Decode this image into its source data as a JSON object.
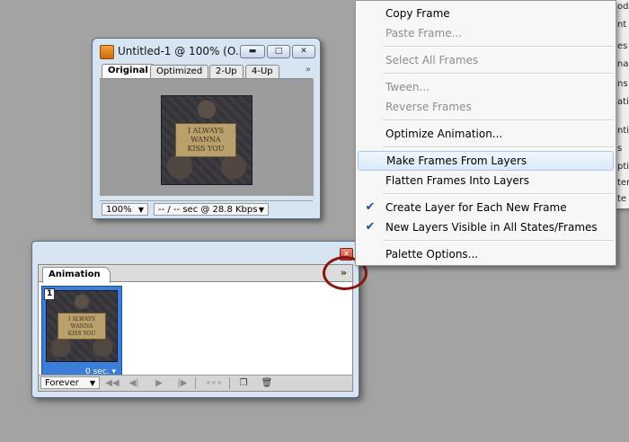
{
  "doc_window": {
    "title": "Untitled-1 @ 100% (O...",
    "controls": {
      "minimize": "▬",
      "maximize": "□",
      "close": "✕"
    },
    "tabs": [
      "Original",
      "Optimized",
      "2-Up",
      "4-Up"
    ],
    "tabs_more": "»",
    "artwork_text": "I ALWAYS\nWANNA\nKISS YOU",
    "zoom": "100%",
    "download_info": "-- / -- sec @ 28.8 Kbps"
  },
  "animation_panel": {
    "tab": "Animation",
    "menu_button": "»",
    "close": "✕",
    "frames": [
      {
        "number": "1",
        "delay": "0 sec.",
        "artwork_text": "I ALWAYS\nWANNA\nKISS YOU"
      }
    ],
    "loop": "Forever",
    "controls": [
      "first-frame",
      "previous-frame",
      "play",
      "next-frame",
      "tween",
      "duplicate-frame",
      "delete-frame"
    ]
  },
  "context_menu": {
    "groups": [
      [
        {
          "label": "Copy Frame",
          "enabled": true
        },
        {
          "label": "Paste Frame...",
          "enabled": false
        }
      ],
      [
        {
          "label": "Select All Frames",
          "enabled": false
        }
      ],
      [
        {
          "label": "Tween...",
          "enabled": false
        },
        {
          "label": "Reverse Frames",
          "enabled": false
        }
      ],
      [
        {
          "label": "Optimize Animation...",
          "enabled": true
        }
      ],
      [
        {
          "label": "Make Frames From Layers",
          "enabled": true,
          "highlighted": true
        },
        {
          "label": "Flatten Frames Into Layers",
          "enabled": true
        }
      ],
      [
        {
          "label": "Create Layer for Each New Frame",
          "enabled": true,
          "checked": true
        },
        {
          "label": "New Layers Visible in All States/Frames",
          "enabled": true,
          "checked": true
        }
      ],
      [
        {
          "label": "Palette Options...",
          "enabled": true
        }
      ]
    ]
  },
  "background_window_fragments": [
    "od",
    "nt",
    "es",
    "na",
    "ns",
    "ati",
    "nti",
    "s",
    "ptio",
    "ter",
    "te",
    "ad"
  ],
  "colors": {
    "desktop": "#a3a3a3",
    "selected_frame": "#3a7ed8",
    "highlight_circle": "#8a1510",
    "check": "#1a4fa8"
  }
}
